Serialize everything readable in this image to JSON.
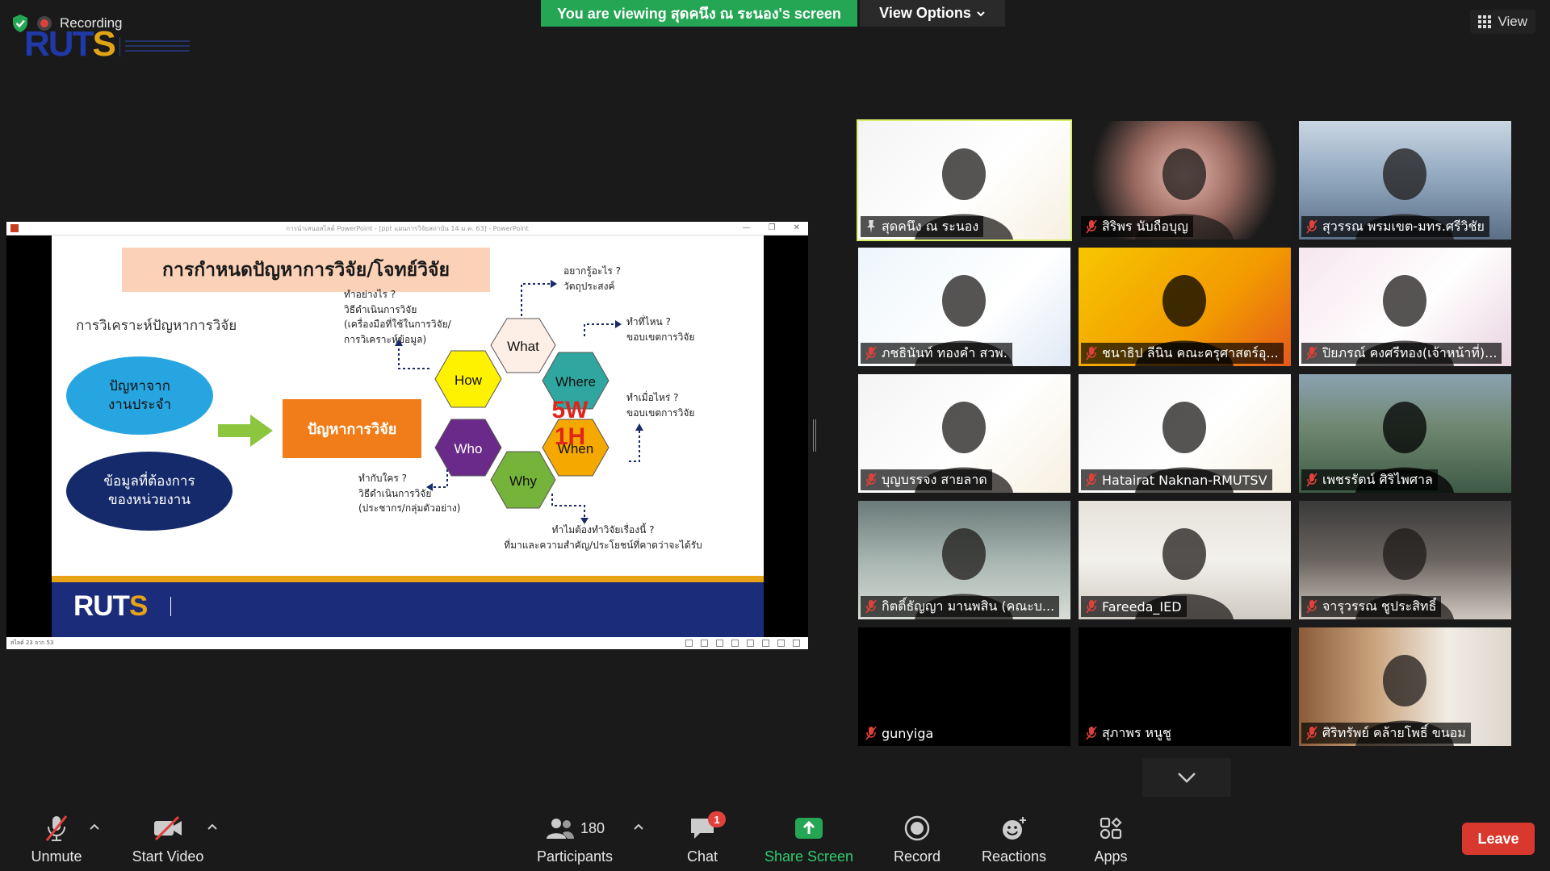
{
  "top": {
    "recording_label": "Recording",
    "viewing_banner": "You are viewing สุดคนึง ณ ระนอง's screen",
    "view_options_label": "View Options",
    "view_label": "View",
    "logo_text_a": "RUT",
    "logo_text_b": "S"
  },
  "slide": {
    "window_title": "การนำเสนอสไลด์ PowerPoint - [ppt แผนการวิจัยสถาบัน 14 ม.ค. 63] - PowerPoint",
    "status_text": "สไลด์ 23 จาก 53",
    "title": "การกำหนดปัญหาการวิจัย/โจทย์วิจัย",
    "subtitle": "การวิเคราะห์ปัญหาการวิจัย",
    "oval1": "ปัญหาจาก\nงานประจำ",
    "oval2": "ข้อมูลที่ต้องการ\nของหน่วยงาน",
    "problem_box": "ปัญหาการวิจัย",
    "center_5w": "5W",
    "center_1h": "1H",
    "hex": {
      "what": "What",
      "where": "Where",
      "when": "When",
      "why": "Why",
      "who": "Who",
      "how": "How"
    },
    "notes": {
      "what": "อยากรู้อะไร ?\nวัตถุประสงค์",
      "where": "ทำที่ไหน ?\nขอบเขตการวิจัย",
      "when": "ทำเมื่อไหร่ ?\nขอบเขตการวิจัย",
      "why": "ทำไมต้องทำวิจัยเรื่องนี้ ?\nที่มาและความสำคัญ/ประโยชน์ที่คาดว่าจะได้รับ",
      "who": "ทำกับใคร ?\nวิธีดำเนินการวิจัย\n(ประชากร/กลุ่มตัวอย่าง)",
      "how": "ทำอย่างไร ?\nวิธีดำเนินการวิจัย\n(เครื่องมือที่ใช้ในการวิจัย/\nการวิเคราะห์ข้อมูล)"
    },
    "footer_logo_a": "RUT",
    "footer_logo_b": "S",
    "colors": {
      "what": "#fdeee6",
      "where": "#2fa6a0",
      "when": "#f5a800",
      "why": "#76b33a",
      "who": "#6a2a8a",
      "how": "#fff200"
    }
  },
  "participants": [
    {
      "name": "สุดคนึง ณ ระนอง",
      "active": true,
      "pinned": true,
      "bg": "ruts"
    },
    {
      "name": "สิริพร นับถือบุญ",
      "bg": "portrait"
    },
    {
      "name": "สุวรรณ  พรมเขต-มทร.ศรีวิชัย",
      "bg": "office"
    },
    {
      "name": "ภชธินันท์  ทองคำ  สวพ.",
      "bg": "ruts2"
    },
    {
      "name": "ชนาธิป ลีนิน คณะครุศาสตร์อุ...",
      "bg": "yellow"
    },
    {
      "name": "ปิยภรณ์ คงศรีทอง(เจ้าหน้าที่)...",
      "bg": "pink"
    },
    {
      "name": "บุญบรรจง  สายลาด",
      "bg": "ruts"
    },
    {
      "name": "Hatairat Naknan-RMUTSV",
      "bg": "ruts"
    },
    {
      "name": "เพชรรัตน์ ศิริไพศาล",
      "bg": "landscape"
    },
    {
      "name": "กิตติ์ธัญญา มานพสิน (คณะบ...",
      "bg": "room"
    },
    {
      "name": "Fareeda_IED",
      "bg": "white-room"
    },
    {
      "name": "จารุวรรณ ชูประสิทธิ์",
      "bg": "dark-room"
    },
    {
      "name": "gunyiga",
      "bg": "black"
    },
    {
      "name": "สุภาพร  หนูชู",
      "bg": "black"
    },
    {
      "name": "ศิริทรัพย์ คล้ายโพธิ์ ขนอม",
      "bg": "library"
    }
  ],
  "toolbar": {
    "unmute": "Unmute",
    "start_video": "Start Video",
    "participants": "Participants",
    "participants_count": "180",
    "chat": "Chat",
    "chat_badge": "1",
    "share_screen": "Share Screen",
    "record": "Record",
    "reactions": "Reactions",
    "apps": "Apps",
    "leave": "Leave"
  }
}
